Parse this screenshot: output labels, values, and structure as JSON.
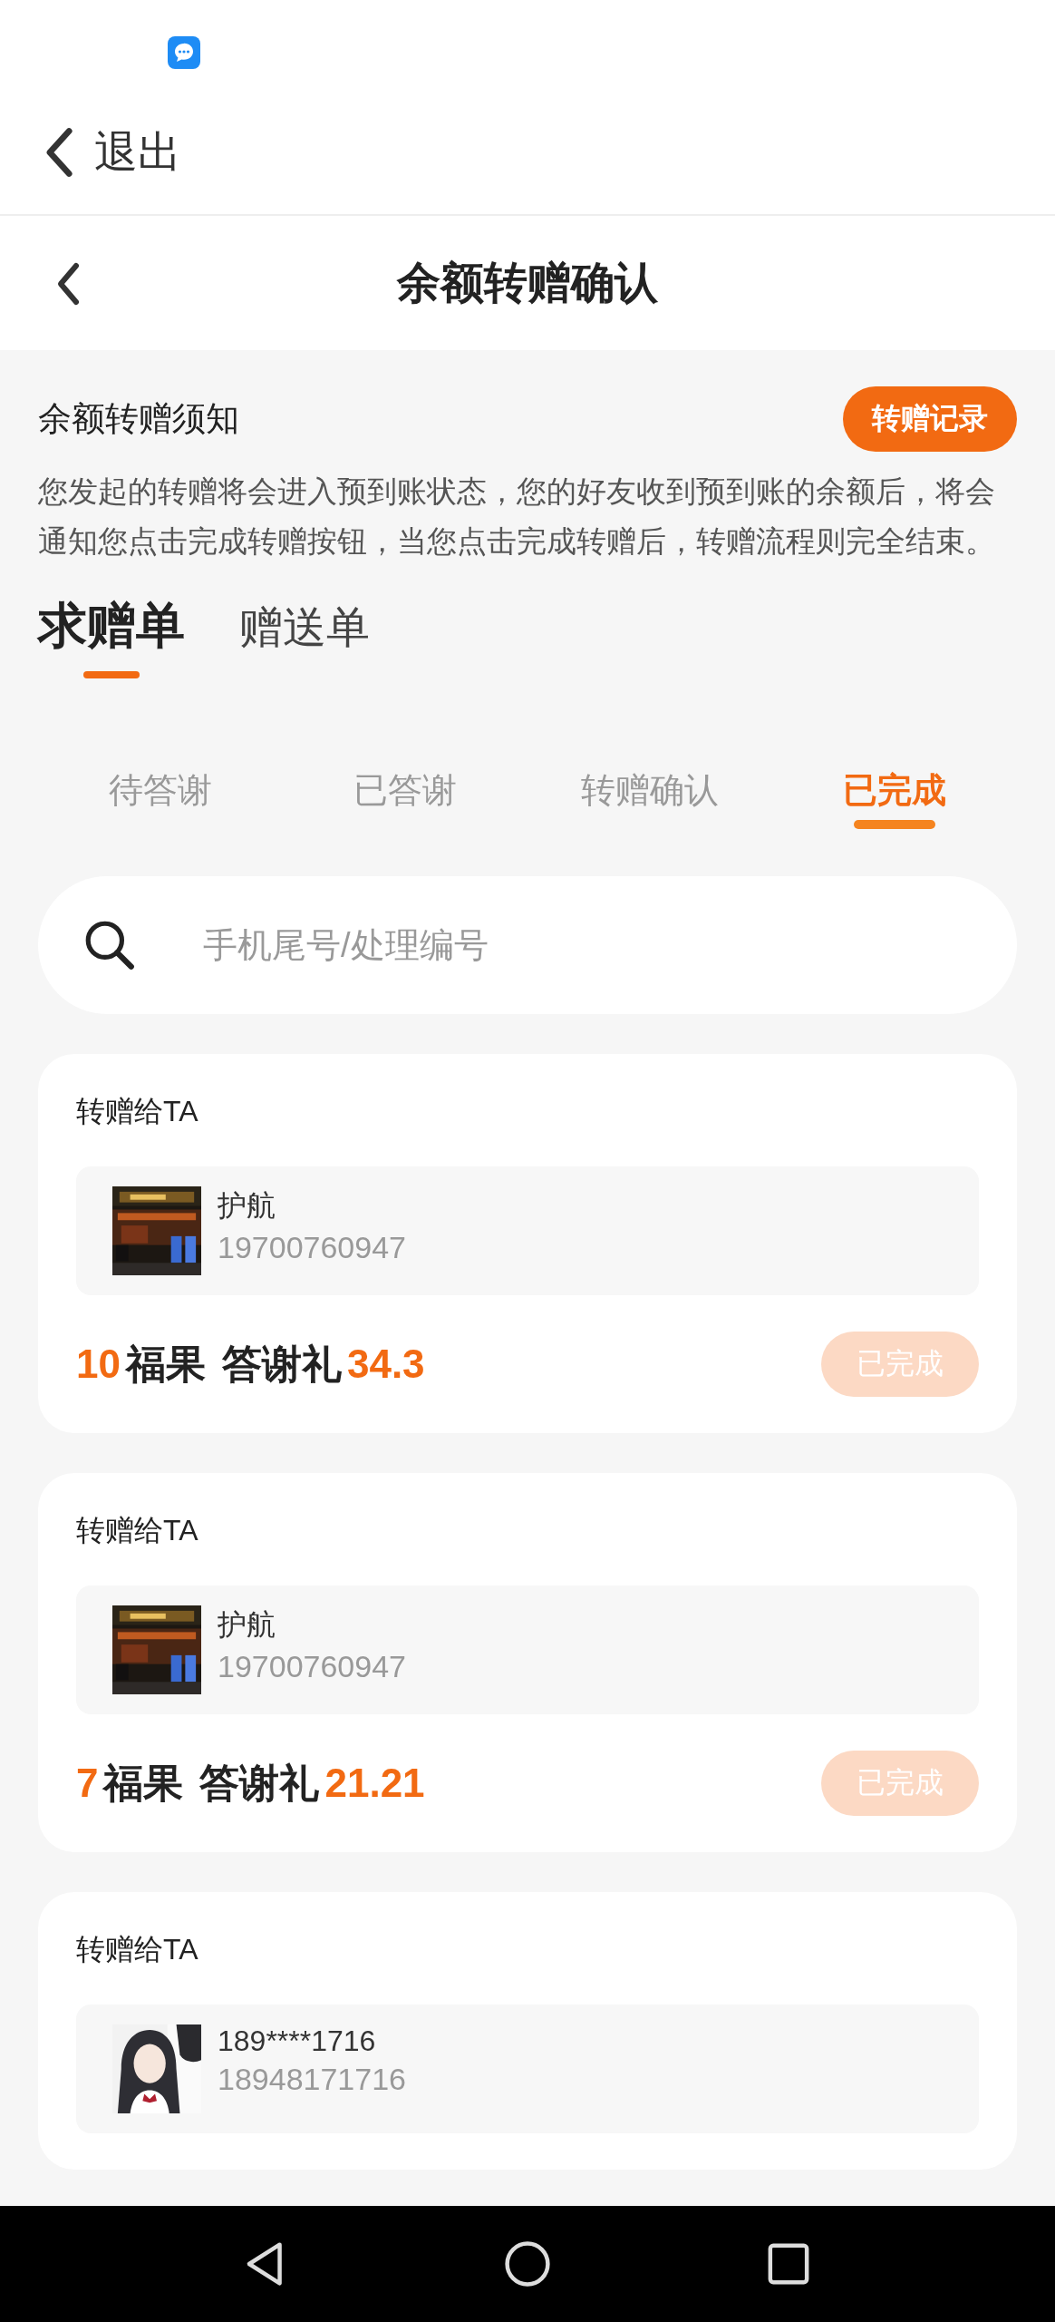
{
  "exit_bar": {
    "label": "退出"
  },
  "title_bar": {
    "title": "余额转赠确认"
  },
  "notice": {
    "title": "余额转赠须知",
    "button": "转赠记录",
    "text": "您发起的转赠将会进入预到账状态，您的好友收到预到账的余额后，将会通知您点击完成转赠按钮，当您点击完成转赠后，转赠流程则完全结束。"
  },
  "tabs": [
    {
      "label": "求赠单",
      "selected": true
    },
    {
      "label": "赠送单",
      "selected": false
    }
  ],
  "sub_tabs": [
    {
      "label": "待答谢",
      "selected": false
    },
    {
      "label": "已答谢",
      "selected": false
    },
    {
      "label": "转赠确认",
      "selected": false
    },
    {
      "label": "已完成",
      "selected": true
    }
  ],
  "search": {
    "placeholder": "手机尾号/处理编号"
  },
  "records": [
    {
      "kind": "store",
      "heading": "转赠给TA",
      "name": "护航",
      "phone": "19700760947",
      "count": "10",
      "unit": "福果",
      "label": "答谢礼",
      "reward": "34.3",
      "status": "已完成"
    },
    {
      "kind": "store",
      "heading": "转赠给TA",
      "name": "护航",
      "phone": "19700760947",
      "count": "7",
      "unit": "福果",
      "label": "答谢礼",
      "reward": "21.21",
      "status": "已完成"
    },
    {
      "kind": "person",
      "heading": "转赠给TA",
      "name": "189****1716",
      "phone": "18948171716"
    }
  ]
}
